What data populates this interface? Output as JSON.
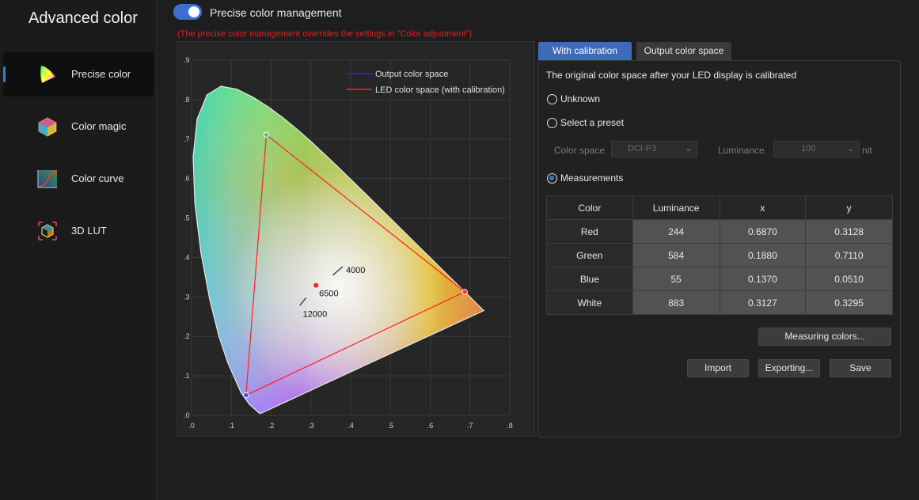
{
  "sidebar": {
    "title": "Advanced color",
    "items": [
      {
        "label": "Precise color",
        "icon": "gamut-triangle-icon",
        "active": true
      },
      {
        "label": "Color magic",
        "icon": "color-cube-icon",
        "active": false
      },
      {
        "label": "Color curve",
        "icon": "curve-graph-icon",
        "active": false
      },
      {
        "label": "3D LUT",
        "icon": "lut-cube-icon",
        "active": false
      }
    ]
  },
  "header": {
    "toggle_label": "Precise color management",
    "toggle_on": true,
    "warning": "(The precise color management overrides the settings in \"Color adjustment\")"
  },
  "chart_data": {
    "type": "scatter",
    "title": "",
    "xlabel": "",
    "ylabel": "",
    "xlim": [
      0,
      0.8
    ],
    "ylim": [
      0,
      0.9
    ],
    "x_ticks": [
      ".0",
      ".1",
      ".2",
      ".3",
      ".4",
      ".5",
      ".6",
      ".7",
      ".8"
    ],
    "y_ticks": [
      ".0",
      ".1",
      ".2",
      ".3",
      ".4",
      ".5",
      ".6",
      ".7",
      ".8",
      ".9"
    ],
    "grid": true,
    "legend_position": "top-right",
    "series": [
      {
        "name": "Output color space",
        "color": "#1a2cff",
        "points": []
      },
      {
        "name": "LED color space (with calibration)",
        "color": "#ff2020",
        "points": [
          [
            0.687,
            0.3128
          ],
          [
            0.188,
            0.711
          ],
          [
            0.137,
            0.051
          ]
        ]
      }
    ],
    "white_point": [
      0.3127,
      0.3295
    ],
    "cct_labels": [
      {
        "text": "4000",
        "x": 0.38,
        "y": 0.377
      },
      {
        "text": "6500",
        "x": 0.3127,
        "y": 0.3295
      },
      {
        "text": "12000",
        "x": 0.272,
        "y": 0.278
      }
    ]
  },
  "tabs": [
    {
      "label": "With calibration",
      "active": true
    },
    {
      "label": "Output color space",
      "active": false
    }
  ],
  "calibration": {
    "description": "The original color space after your LED display is calibrated",
    "options": [
      {
        "label": "Unknown",
        "checked": false
      },
      {
        "label": "Select a preset",
        "checked": false
      },
      {
        "label": "Measurements",
        "checked": true
      }
    ],
    "preset": {
      "color_space_label": "Color space",
      "color_space_value": "DCI-P3",
      "luminance_label": "Luminance",
      "luminance_value": "100",
      "unit": "nit"
    },
    "table": {
      "headers": [
        "Color",
        "Luminance",
        "x",
        "y"
      ],
      "rows": [
        [
          "Red",
          "244",
          "0.6870",
          "0.3128"
        ],
        [
          "Green",
          "584",
          "0.1880",
          "0.7110"
        ],
        [
          "Blue",
          "55",
          "0.1370",
          "0.0510"
        ],
        [
          "White",
          "883",
          "0.3127",
          "0.3295"
        ]
      ]
    },
    "buttons": {
      "measuring": "Measuring colors...",
      "import": "Import",
      "export": "Exporting...",
      "save": "Save"
    }
  }
}
